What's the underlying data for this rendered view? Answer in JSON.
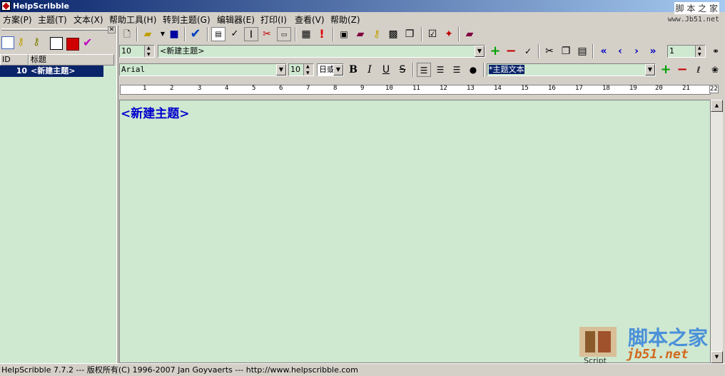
{
  "window": {
    "title": "HelpScribble"
  },
  "menu": [
    "方案(P)",
    "主题(T)",
    "文本(X)",
    "帮助工具(H)",
    "转到主题(G)",
    "编辑器(E)",
    "打印(I)",
    "查看(V)",
    "帮助(Z)"
  ],
  "watermark": {
    "top": "脚 本 之 家",
    "url": "www.Jb51.net",
    "brand": "脚本之家",
    "site": "jb51.net",
    "script": "Script"
  },
  "topic_list": {
    "columns": [
      "ID",
      "标题"
    ],
    "rows": [
      {
        "id": "10",
        "title": "<新建主题>"
      }
    ]
  },
  "topic_bar": {
    "id_value": "10",
    "title_value": "<新建主题>",
    "nav_value": "1"
  },
  "format_bar": {
    "font": "Arial",
    "size": "10",
    "lang": "日或",
    "style": "*主题文本"
  },
  "ruler": {
    "ticks": [
      "1",
      "2",
      "3",
      "4",
      "5",
      "6",
      "7",
      "8",
      "9",
      "10",
      "11",
      "12",
      "13",
      "14",
      "15",
      "16",
      "17",
      "18",
      "19",
      "20",
      "21",
      "22"
    ]
  },
  "editor": {
    "text": "<新建主题>"
  },
  "status": {
    "text": "HelpScribble 7.7.2   ---   版权所有(C) 1996-2007  Jan Goyvaerts   ---   http://www.helpscribble.com"
  },
  "colors": {
    "editor_bg": "#cfe8d0",
    "selection": "#0a246a",
    "topic_text": "#0000cc"
  }
}
